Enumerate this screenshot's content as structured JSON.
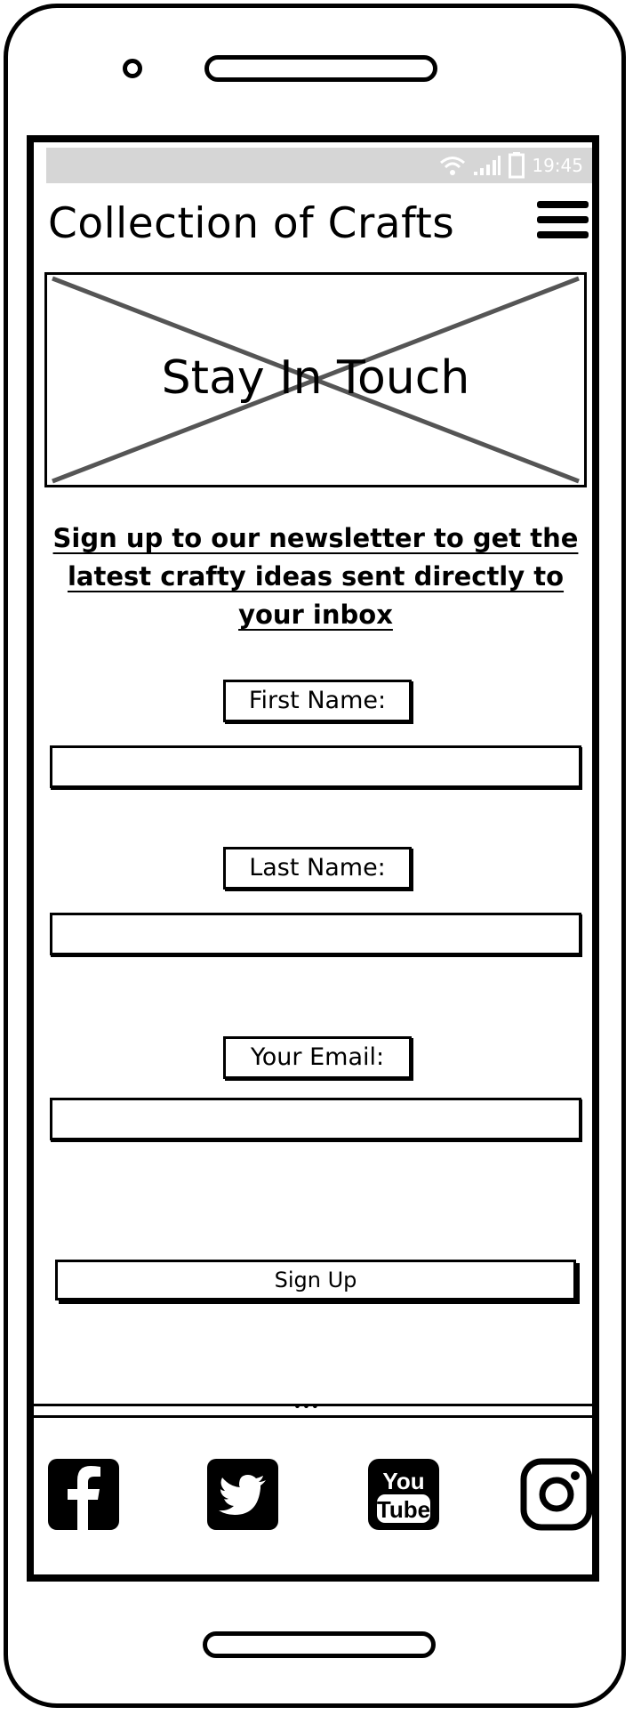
{
  "status_bar": {
    "time": "19:45"
  },
  "header": {
    "title": "Collection of Crafts"
  },
  "hero": {
    "title": "Stay In Touch"
  },
  "intro": {
    "text": "Sign up to our newsletter to get the latest crafty ideas sent directly to your inbox"
  },
  "form": {
    "first_name_label": "First Name:",
    "first_name_value": "",
    "last_name_label": "Last Name:",
    "last_name_value": "",
    "email_label": "Your Email:",
    "email_value": "",
    "submit_label": "Sign Up"
  },
  "footer": {
    "icons": [
      "facebook-icon",
      "twitter-icon",
      "youtube-icon",
      "instagram-icon"
    ]
  }
}
